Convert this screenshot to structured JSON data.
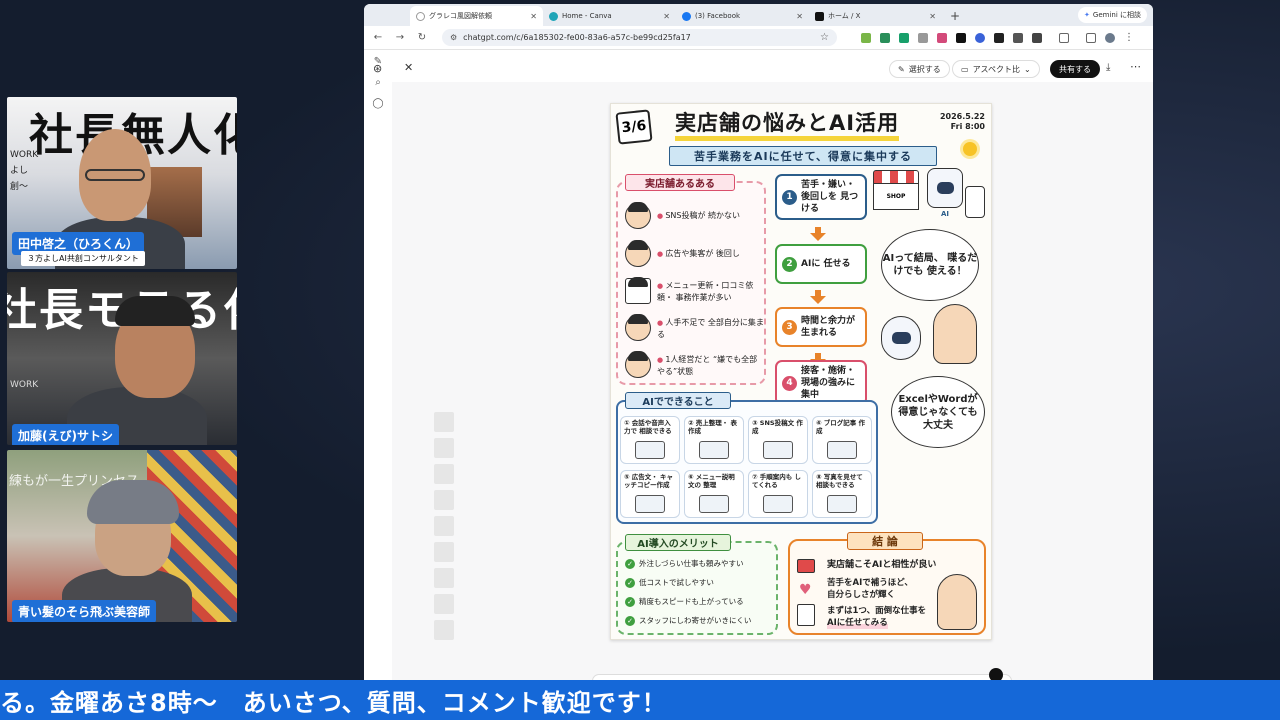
{
  "participants": [
    {
      "name": "田中啓之（ひろくん）",
      "subtitle": "３方よしAI共創コンサルタント",
      "backdrop_text": "社長無人化",
      "backdrop_small": [
        "WORK",
        "よし",
        "創～"
      ]
    },
    {
      "name": "加藤(えび)サトシ",
      "backdrop_text": "社長モテる化",
      "backdrop_small": [
        "WORK"
      ]
    },
    {
      "name": "青い髪のそら飛ぶ美容師",
      "backdrop_text": "練もが一生プリンセス"
    }
  ],
  "browser": {
    "tabs": [
      {
        "label": "グラレコ風図解依頼",
        "active": true,
        "favicon": "chatgpt-icon"
      },
      {
        "label": "Home - Canva",
        "active": false,
        "favicon": "canva-icon"
      },
      {
        "label": "(3) Facebook",
        "active": false,
        "favicon": "facebook-icon"
      },
      {
        "label": "ホーム / X",
        "active": false,
        "favicon": "x-icon"
      }
    ],
    "new_tab": "+",
    "gemini_button": "Gemini に相談",
    "url": "chatgpt.com/c/6a185302-fe00-83a6-a57c-be99cd25fa17"
  },
  "chat": {
    "select_button": "選択する",
    "aspect_button": "アスペクト比",
    "share_button": "共有する"
  },
  "infographic": {
    "page": "3/6",
    "title": "実店舗の悩みとAI活用",
    "date_line1": "2026.5.22",
    "date_line2": "Fri 8:00",
    "subtitle": "苦手業務をAIに任せて、得意に集中する",
    "aruaru_header": "実店舗あるある",
    "aruaru": [
      "SNS投稿が 続かない",
      "広告や集客が 後回し",
      "メニュー更新・口コミ依頼・ 事務作業が多い",
      "人手不足で 全部自分に集まる",
      "1人経営だと “嫌でも全部やる”状態"
    ],
    "steps": [
      {
        "num": "1",
        "text": "苦手・嫌い・ 後回しを 見つける"
      },
      {
        "num": "2",
        "text": "AIに 任せる"
      },
      {
        "num": "3",
        "text": "時間と余力が 生まれる"
      },
      {
        "num": "4",
        "text": "接客・施術・ 現場の強みに 集中"
      }
    ],
    "shop_sign": "SHOP",
    "robot_label": "AI",
    "bubble1": "AIって結局、 喋るだけでも 使える！",
    "bubble2": "ExcelやWordが 得意じゃなくても 大丈夫",
    "can_header": "AIでできること",
    "can": [
      "① 会話や音声入力で 相談できる",
      "② 売上整理・ 表作成",
      "③ SNS投稿文 作成",
      "④ ブログ記事 作成",
      "⑤ 広告文・ キャッチコピー作成",
      "⑥ メニュー説明文の 整理",
      "⑦ 手順案内も してくれる",
      "⑧ 写真を見せて 相談もできる"
    ],
    "merit_header": "AI導入のメリット",
    "merits": [
      "外注しづらい仕事も頼みやすい",
      "低コストで試しやすい",
      "精度もスピードも上がっている",
      "スタッフにしわ寄せがいきにくい"
    ],
    "conclusion_header": "結 論",
    "conclusion_lead": "実店舗こそAIと相性が良い",
    "conclusion_body1": "苦手をAIで補うほど、",
    "conclusion_body2": "自分らしさが輝く",
    "conclusion_body3": "まずは1つ、面倒な仕事を",
    "conclusion_body4": "AIに任せてみる"
  },
  "ticker": "る。金曜あさ8時～　あいさつ、質問、コメント歓迎です！",
  "colors": {
    "ticker_bg": "#1568d8",
    "nametag_bg": "#1f6fd6",
    "background": "#141d2e"
  }
}
